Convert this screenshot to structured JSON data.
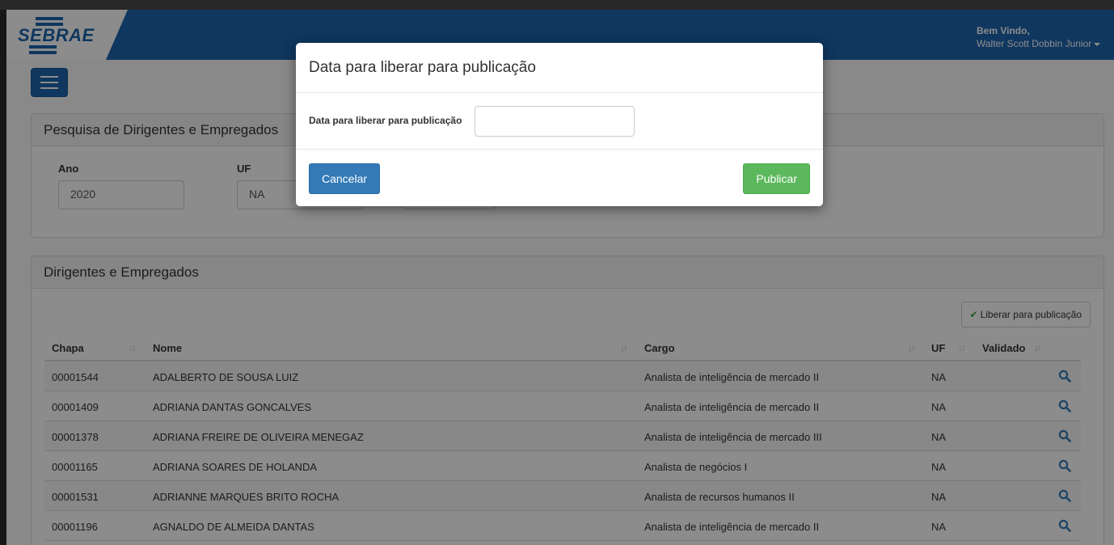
{
  "brand": {
    "logo_text": "SEBRAE"
  },
  "header": {
    "greeting": "Bem Vindo,",
    "user_name": "Walter Scott Dobbin Junior"
  },
  "search": {
    "title": "Pesquisa de Dirigentes e Empregados",
    "fields": [
      {
        "label": "Ano",
        "value": "2020"
      },
      {
        "label": "UF",
        "value": "NA"
      },
      {
        "label": "",
        "value": ""
      }
    ]
  },
  "list": {
    "title": "Dirigentes e Empregados",
    "release_button": "Liberar para publicação",
    "columns": [
      "Chapa",
      "Nome",
      "Cargo",
      "UF",
      "Validado"
    ],
    "rows": [
      {
        "chapa": "00001544",
        "nome": "ADALBERTO DE SOUSA LUIZ",
        "cargo": "Analista de inteligência de mercado II",
        "uf": "NA"
      },
      {
        "chapa": "00001409",
        "nome": "ADRIANA DANTAS GONCALVES",
        "cargo": "Analista de inteligência de mercado II",
        "uf": "NA"
      },
      {
        "chapa": "00001378",
        "nome": "ADRIANA FREIRE DE OLIVEIRA MENEGAZ",
        "cargo": "Analista de inteligência de mercado III",
        "uf": "NA"
      },
      {
        "chapa": "00001165",
        "nome": "ADRIANA SOARES DE HOLANDA",
        "cargo": "Analista de negócios I",
        "uf": "NA"
      },
      {
        "chapa": "00001531",
        "nome": "ADRIANNE MARQUES BRITO ROCHA",
        "cargo": "Analista de recursos humanos II",
        "uf": "NA"
      },
      {
        "chapa": "00001196",
        "nome": "AGNALDO DE ALMEIDA DANTAS",
        "cargo": "Analista de inteligência de mercado II",
        "uf": "NA"
      }
    ]
  },
  "modal": {
    "title": "Data para liberar para publicação",
    "field_label": "Data para liberar para publicação",
    "field_value": "",
    "cancel_label": "Cancelar",
    "publish_label": "Publicar"
  },
  "icons": {
    "menu": "hamburger-icon",
    "check": "check-icon",
    "sort": "sort-icon",
    "view": "search-icon"
  },
  "colors": {
    "brand": "#1c64ae",
    "primary": "#337ab7",
    "success": "#5cb85c",
    "check": "#3a9d3a"
  }
}
